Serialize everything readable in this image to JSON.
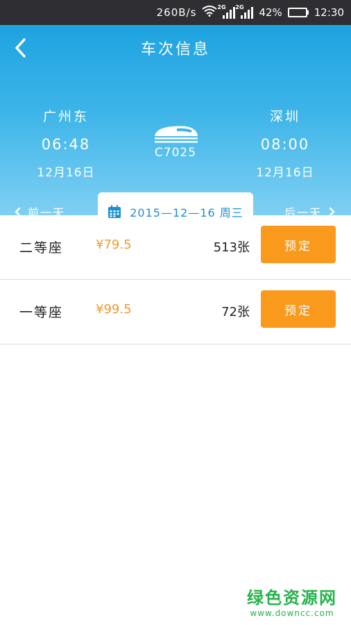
{
  "status_bar": {
    "net_speed": "260B/s",
    "sim1": "2G",
    "sim2": "2G",
    "battery": "42%",
    "battery_level": 0.42,
    "time": "12:30"
  },
  "header": {
    "back_icon": "chevron-left-icon",
    "title": "车次信息"
  },
  "trip": {
    "from": {
      "station": "广州东",
      "time": "06:48",
      "date": "12月16日"
    },
    "to": {
      "station": "深圳",
      "time": "08:00",
      "date": "12月16日"
    },
    "train_icon": "train-icon",
    "train_no": "C7025"
  },
  "day_nav": {
    "prev_label": "前一天",
    "next_label": "后一天",
    "date_text": "2015—12—16 周三",
    "calendar_icon": "calendar-icon"
  },
  "seats": [
    {
      "name": "二等座",
      "price": "¥79.5",
      "count": "513张",
      "book_label": "预定"
    },
    {
      "name": "一等座",
      "price": "¥99.5",
      "count": "72张",
      "book_label": "预定"
    }
  ],
  "watermark": {
    "main": "绿色资源网",
    "sub": "www.downcc.com"
  },
  "colors": {
    "header_gradient_top": "#1ea3e0",
    "header_gradient_bottom": "#7fd0f3",
    "price": "#f39a2a",
    "book_button": "#f99a1c",
    "date_text": "#1b8fd0",
    "watermark": "#26b24a"
  }
}
